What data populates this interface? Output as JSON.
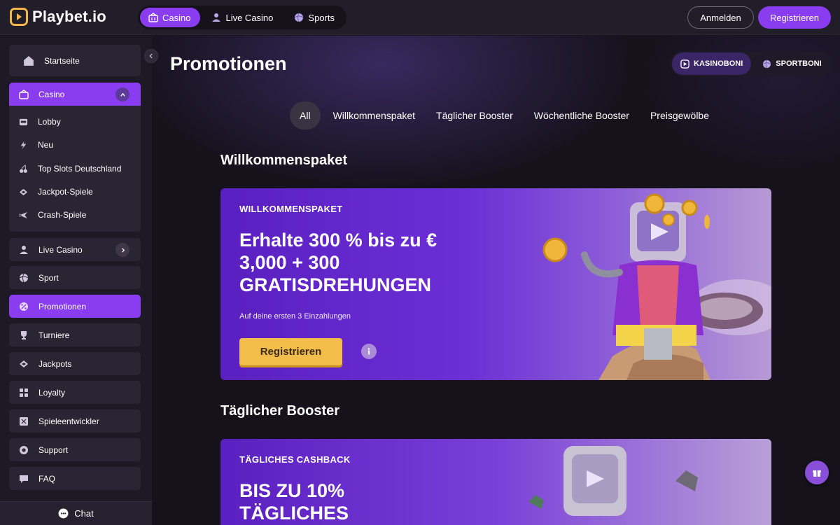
{
  "brand": {
    "name": "Playbet.io"
  },
  "topnav": {
    "items": [
      {
        "label": "Casino",
        "icon": "casino-icon"
      },
      {
        "label": "Live Casino",
        "icon": "dealer-icon"
      },
      {
        "label": "Sports",
        "icon": "ball-icon"
      }
    ],
    "active": "Casino"
  },
  "auth": {
    "login_label": "Anmelden",
    "register_label": "Registrieren"
  },
  "sidebar": {
    "home": {
      "label": "Startseite",
      "icon": "home-icon"
    },
    "casino": {
      "label": "Casino",
      "icon": "casino-icon",
      "expanded": true
    },
    "casino_items": [
      {
        "label": "Lobby",
        "icon": "slot-machine-icon"
      },
      {
        "label": "Neu",
        "icon": "lightning-icon"
      },
      {
        "label": "Top Slots Deutschland",
        "icon": "cherry-icon"
      },
      {
        "label": "Jackpot-Spiele",
        "icon": "jackpot-icon"
      },
      {
        "label": "Crash-Spiele",
        "icon": "plane-icon"
      }
    ],
    "live_casino": {
      "label": "Live Casino",
      "icon": "dealer-icon"
    },
    "items": [
      {
        "label": "Sport",
        "icon": "ball-icon"
      },
      {
        "label": "Promotionen",
        "icon": "percent-icon"
      },
      {
        "label": "Turniere",
        "icon": "trophy-icon"
      },
      {
        "label": "Jackpots",
        "icon": "jackpot-icon"
      },
      {
        "label": "Loyalty",
        "icon": "grid-icon"
      },
      {
        "label": "Spieleentwickler",
        "icon": "puzzle-icon"
      },
      {
        "label": "Support",
        "icon": "lifebuoy-icon"
      },
      {
        "label": "FAQ",
        "icon": "chat-bubble-icon"
      }
    ],
    "active": "Promotionen",
    "chat_label": "Chat"
  },
  "main": {
    "title": "Promotionen",
    "bonus_tabs": [
      {
        "label": "KASINOBONI",
        "active": true
      },
      {
        "label": "SPORTBONI",
        "active": false
      }
    ],
    "filters": [
      "All",
      "Willkommenspaket",
      "Täglicher Booster",
      "Wöchentliche Booster",
      "Preisgewölbe"
    ],
    "active_filter": "All",
    "sections": [
      {
        "title": "Willkommenspaket",
        "promo": {
          "label": "WILLKOMMENSPAKET",
          "headline": "Erhalte 300 % bis zu € 3,000 + 300 GRATISDREHUNGEN",
          "subtext": "Auf deine ersten 3 Einzahlungen",
          "cta": "Registrieren"
        }
      },
      {
        "title": "Täglicher Booster",
        "promo": {
          "label": "TÄGLICHES CASHBACK",
          "headline": "BIS ZU 10% TÄGLICHES"
        }
      }
    ]
  },
  "colors": {
    "accent": "#8a3df0",
    "background": "#15121b",
    "sidebar": "#1d1925",
    "cta_yellow": "#f3bd4c"
  }
}
